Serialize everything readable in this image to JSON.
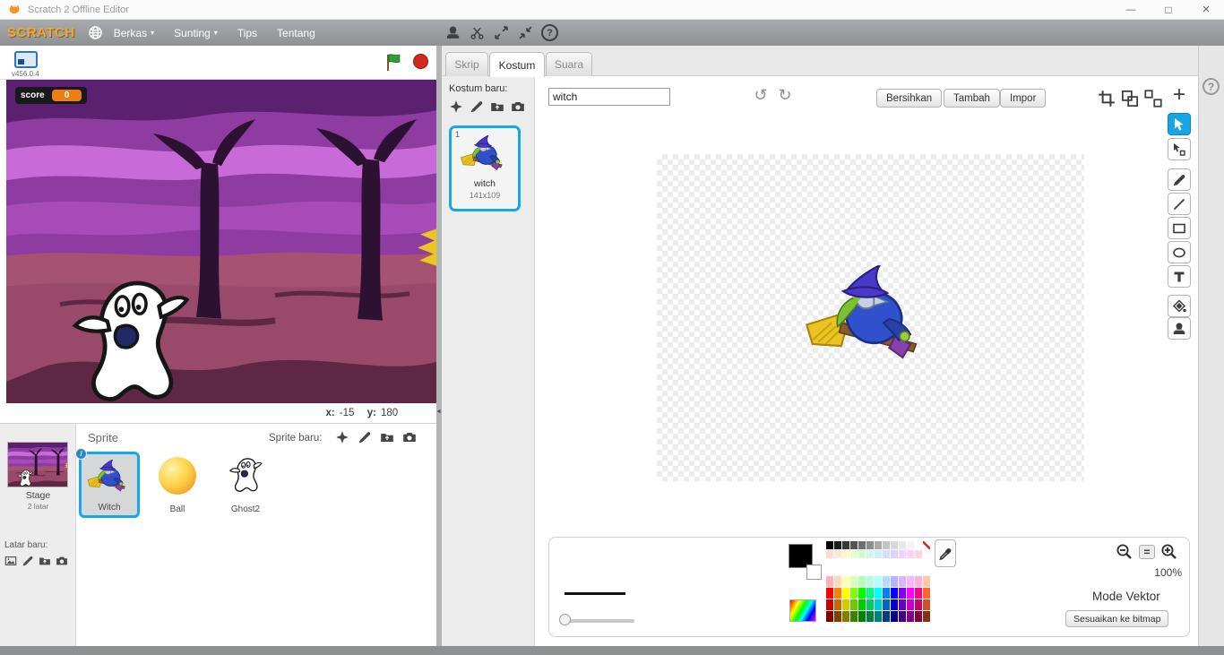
{
  "window": {
    "title": "Scratch 2 Offline Editor"
  },
  "glyphs": {
    "minimize": "—",
    "maximize": "□",
    "close": "×",
    "dropdown": "▾",
    "undo": "↺",
    "redo": "↻",
    "plus": "+",
    "equals": "=",
    "help": "?",
    "info": "i",
    "panel_arrow": "◄"
  },
  "menubar": {
    "logo": "SCRATCH",
    "items": [
      {
        "label": "Berkas",
        "dropdown": true
      },
      {
        "label": "Sunting",
        "dropdown": true
      },
      {
        "label": "Tips",
        "dropdown": false
      },
      {
        "label": "Tentang",
        "dropdown": false
      }
    ]
  },
  "stage": {
    "version": "v456.0.4",
    "variable": {
      "name": "score",
      "value": "0"
    },
    "coords": {
      "x_label": "x:",
      "x_value": "-15",
      "y_label": "y:",
      "y_value": "180"
    }
  },
  "sprite_panel": {
    "title": "Sprite",
    "new_sprite_label": "Sprite baru:",
    "new_backdrop_label": "Latar baru:",
    "stage_item": {
      "name": "Stage",
      "info": "2 latar"
    },
    "sprites": [
      {
        "name": "Witch",
        "selected": true
      },
      {
        "name": "Ball",
        "selected": false
      },
      {
        "name": "Ghost2",
        "selected": false
      }
    ]
  },
  "tabs": [
    {
      "label": "Skrip",
      "active": false
    },
    {
      "label": "Kostum",
      "active": true
    },
    {
      "label": "Suara",
      "active": false
    }
  ],
  "costume_panel": {
    "new_label": "Kostum baru:",
    "costumes": [
      {
        "index": "1",
        "name": "witch",
        "size": "141x109",
        "selected": true
      }
    ]
  },
  "paint": {
    "name_value": "witch",
    "buttons": {
      "clear": "Bersihkan",
      "add": "Tambah",
      "import": "Impor"
    },
    "zoom_level": "100%",
    "mode_label": "Mode Vektor",
    "convert_label": "Sesuaikan ke bitmap",
    "colors": {
      "primary": "#000000",
      "secondary": "#ffffff",
      "palette_top": [
        [
          "#000000",
          "#1c1c1c",
          "#383838",
          "#545454",
          "#707070",
          "#8c8c8c",
          "#a8a8a8",
          "#c4c4c4",
          "#d8d8d8",
          "#e8e8e8",
          "#f4f4f4",
          "#ffffff",
          "none"
        ],
        [
          "#ffd9d9",
          "#ffe8d1",
          "#fff8cf",
          "#e9fccf",
          "#d4f7d4",
          "#cff8ea",
          "#cdf1fa",
          "#d2e0fb",
          "#dcd2fb",
          "#efd2fb",
          "#fbd2f3",
          "#ffd6e5",
          "#ffffff"
        ]
      ],
      "palette_main": [
        [
          "#ffb3b3",
          "#ffd9b3",
          "#ffffb3",
          "#d9ffb3",
          "#b3ffb3",
          "#b3ffd9",
          "#b3ffff",
          "#b3d9ff",
          "#b3b3ff",
          "#d9b3ff",
          "#ffb3ff",
          "#ffb3d9",
          "#ffc7a8"
        ],
        [
          "#ff0000",
          "#ff8000",
          "#ffff00",
          "#80ff00",
          "#00ff00",
          "#00ff80",
          "#00ffff",
          "#0080ff",
          "#0000ff",
          "#8000ff",
          "#ff00ff",
          "#ff0080",
          "#ff6633"
        ],
        [
          "#cc0000",
          "#cc6600",
          "#cccc00",
          "#66cc00",
          "#00cc00",
          "#00cc66",
          "#00cccc",
          "#0066cc",
          "#0000cc",
          "#6600cc",
          "#cc00cc",
          "#cc0066",
          "#cc5229"
        ],
        [
          "#800000",
          "#804000",
          "#808000",
          "#408000",
          "#008000",
          "#008040",
          "#008080",
          "#004080",
          "#000080",
          "#400080",
          "#800080",
          "#800040",
          "#803319"
        ]
      ]
    }
  }
}
